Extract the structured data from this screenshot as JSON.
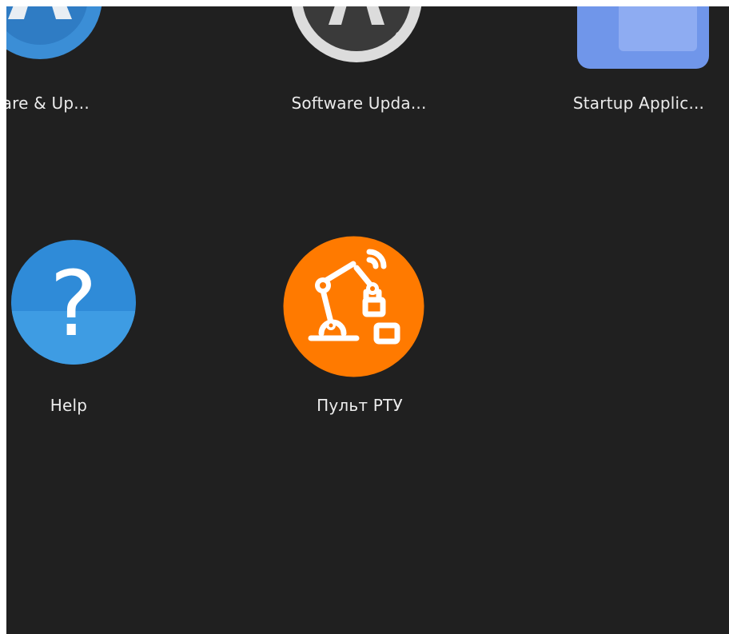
{
  "apps": [
    {
      "name": "Software & Updates",
      "label": "tware & Up...",
      "icon": "software-properties-icon"
    },
    {
      "name": "Software Updater",
      "label": "Software Upda...",
      "icon": "software-updater-icon"
    },
    {
      "name": "Startup Applications",
      "label": "Startup Applic...",
      "icon": "startup-applications-icon"
    },
    {
      "name": "Help",
      "label": "Help",
      "icon": "help-icon"
    },
    {
      "name": "Пульт РТУ",
      "label": "Пульт РТУ",
      "icon": "robot-arm-icon"
    }
  ],
  "colors": {
    "background": "#202020",
    "label_text": "#ececec",
    "help_blue": "#2f8bd8",
    "pult_orange": "#ff7a00",
    "software_blue": "#3b8ed6",
    "startup_blue": "#6b8fe8"
  }
}
